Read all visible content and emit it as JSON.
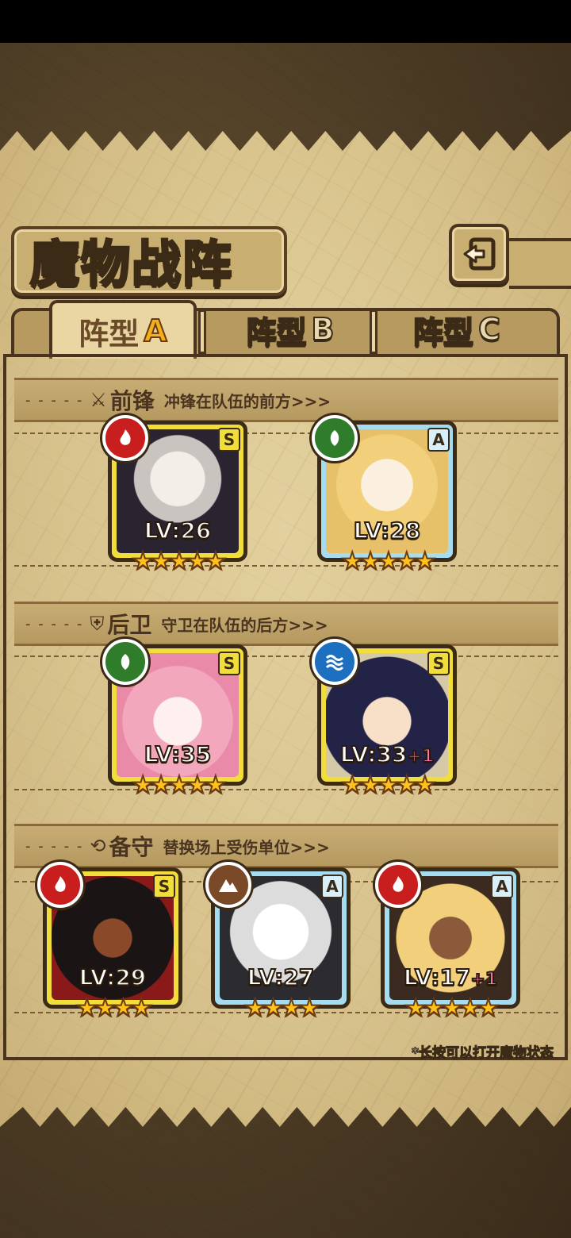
{
  "title": "魔物战阵",
  "tabs": [
    {
      "prefix": "阵型",
      "letter": "A"
    },
    {
      "prefix": "阵型",
      "letter": "B"
    },
    {
      "prefix": "阵型",
      "letter": "C"
    }
  ],
  "sections": [
    {
      "name": "前锋",
      "desc": "冲锋在队伍的前方>>>"
    },
    {
      "name": "后卫",
      "desc": "守卫在队伍的后方>>>"
    },
    {
      "name": "备守",
      "desc": "替换场上受伤单位>>>"
    }
  ],
  "units": [
    {
      "level": "LV:26",
      "plus": "",
      "rank": "S",
      "element": "fire",
      "stars": "★★★★★",
      "frame": "gold"
    },
    {
      "level": "LV:28",
      "plus": "",
      "rank": "A",
      "element": "wood",
      "stars": "★★★★★",
      "frame": "blue"
    },
    {
      "level": "LV:35",
      "plus": "",
      "rank": "S",
      "element": "wood",
      "stars": "★★★★★",
      "frame": "gold"
    },
    {
      "level": "LV:33",
      "plus": "+1",
      "rank": "S",
      "element": "water",
      "stars": "★★★★★",
      "frame": "gold"
    },
    {
      "level": "LV:29",
      "plus": "",
      "rank": "S",
      "element": "fire",
      "stars": "★★★★",
      "frame": "gold"
    },
    {
      "level": "LV:27",
      "plus": "",
      "rank": "A",
      "element": "earth",
      "stars": "★★★★",
      "frame": "blue"
    },
    {
      "level": "LV:17",
      "plus": "+1",
      "rank": "A",
      "element": "fire",
      "stars": "★★★★★",
      "frame": "blue"
    }
  ],
  "hint": "*长按可以打开魔物状态"
}
